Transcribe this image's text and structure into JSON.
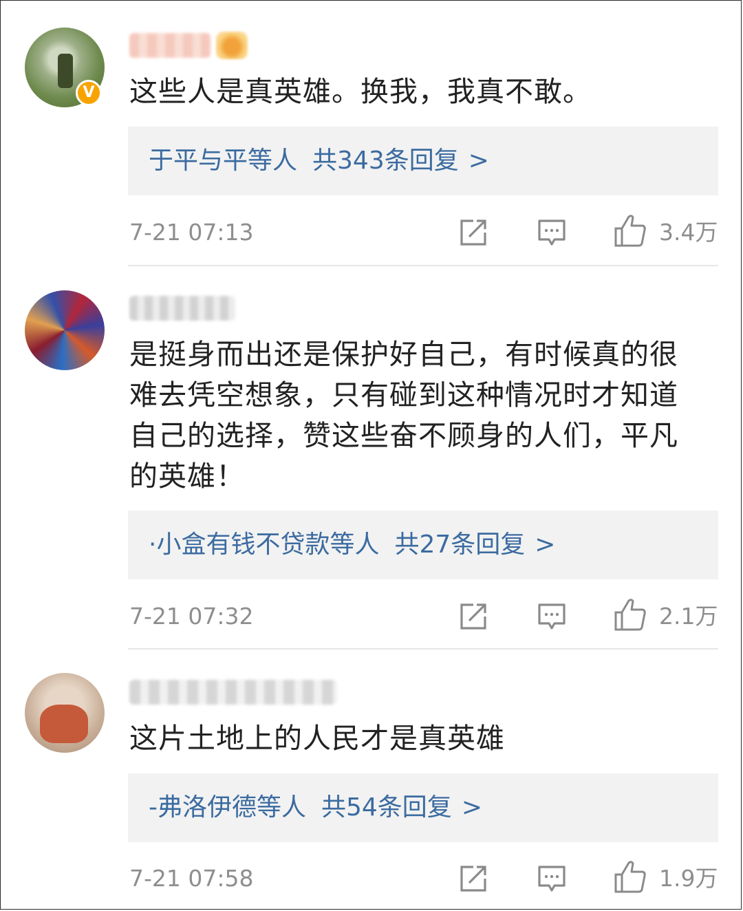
{
  "comments": [
    {
      "username": "",
      "verified": true,
      "text_lines": [
        "这些人是真英雄。换我，我真不敢。"
      ],
      "reply": {
        "prefix": "于平与平等人",
        "count_text": "共343条回复",
        "chevron": ">"
      },
      "time": "7-21 07:13",
      "likes": "3.4万"
    },
    {
      "username": "",
      "verified": false,
      "text_lines": [
        "是挺身而出还是保护好自己，有时候真的很",
        "难去凭空想象，只有碰到这种情况时才知道",
        "自己的选择，赞这些奋不顾身的人们，平凡",
        "的英雄！"
      ],
      "reply": {
        "prefix": "·小盒有钱不贷款等人",
        "count_text": "共27条回复",
        "chevron": ">"
      },
      "time": "7-21 07:32",
      "likes": "2.1万"
    },
    {
      "username": "",
      "verified": false,
      "text_lines": [
        "这片土地上的人民才是真英雄"
      ],
      "reply": {
        "prefix": "-弗洛伊德等人",
        "count_text": "共54条回复",
        "chevron": ">"
      },
      "time": "7-21 07:58",
      "likes": "1.9万"
    }
  ],
  "icons": {
    "edit": "edit-icon",
    "comment": "comment-icon",
    "like": "thumbs-up-icon",
    "verified": "verified-badge-icon"
  },
  "colors": {
    "reply_text": "#3b6ba0",
    "meta_text": "#8e8e8e",
    "reply_bg": "#f2f2f2",
    "verified_badge": "#f7a400"
  }
}
